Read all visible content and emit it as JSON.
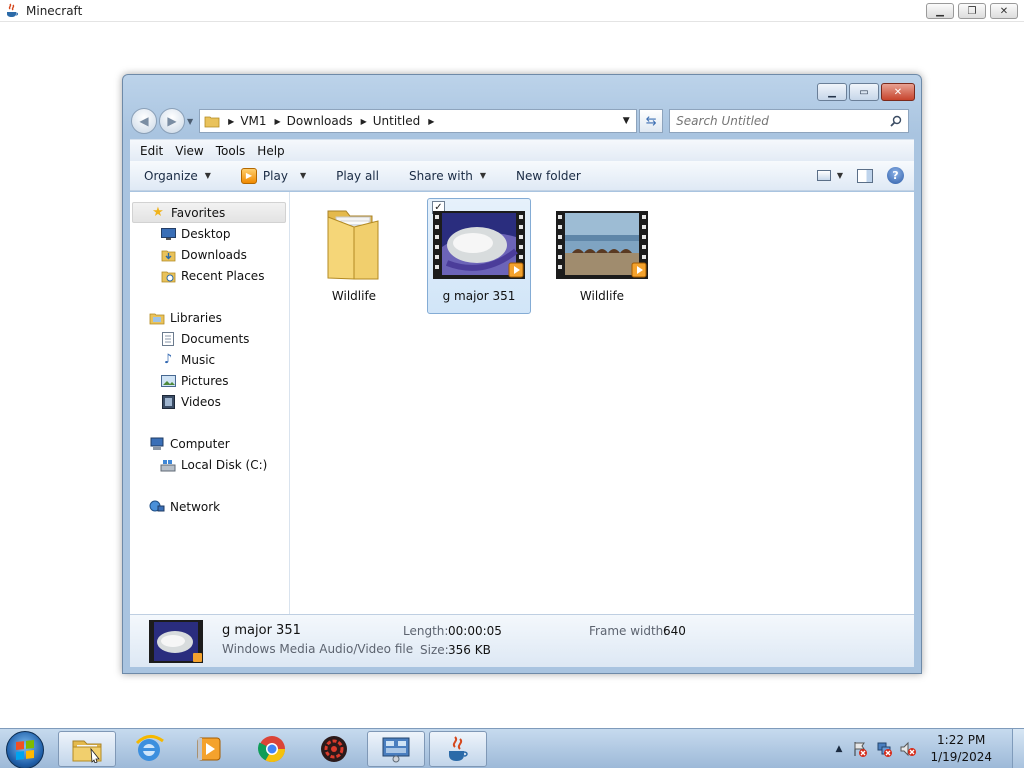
{
  "app": {
    "title": "Minecraft"
  },
  "explorer": {
    "breadcrumb": [
      "VM1",
      "Downloads",
      "Untitled"
    ],
    "search_placeholder": "Search Untitled",
    "menu": [
      "Edit",
      "View",
      "Tools",
      "Help"
    ],
    "commands": {
      "organize": "Organize",
      "play": "Play",
      "play_all": "Play all",
      "share_with": "Share with",
      "new_folder": "New folder"
    },
    "nav": {
      "favorites": "Favorites",
      "desktop": "Desktop",
      "downloads": "Downloads",
      "recent_places": "Recent Places",
      "libraries": "Libraries",
      "documents": "Documents",
      "music": "Music",
      "pictures": "Pictures",
      "videos": "Videos",
      "computer": "Computer",
      "local_disk": "Local Disk (C:)",
      "network": "Network"
    },
    "items": [
      {
        "label": "Wildlife",
        "kind": "folder",
        "selected": false
      },
      {
        "label": "g major 351",
        "kind": "video",
        "selected": true
      },
      {
        "label": "Wildlife",
        "kind": "video",
        "selected": false
      }
    ],
    "details": {
      "name": "g major 351",
      "type": "Windows Media Audio/Video file",
      "length_label": "Length:",
      "length": "00:00:05",
      "size_label": "Size:",
      "size": "356 KB",
      "frame_width_label": "Frame width:",
      "frame_width": "640"
    }
  },
  "taskbar": {
    "time": "1:22 PM",
    "date": "1/19/2024"
  },
  "colors": {
    "accent": "#3d6fb3",
    "selection": "#d1e5f8",
    "close": "#c7442d"
  }
}
